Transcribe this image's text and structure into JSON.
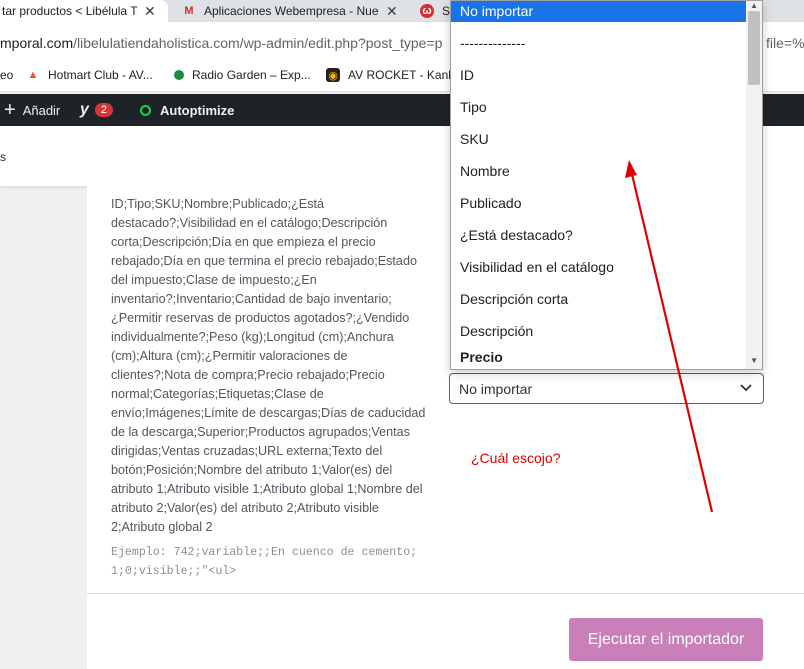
{
  "browser": {
    "tabs": [
      {
        "title": "tar productos < Libélula Ti",
        "close": "✕"
      },
      {
        "title": "Aplicaciones Webempresa - Nue",
        "close": "✕"
      },
      {
        "title": "S"
      }
    ],
    "url_host": "mporal.com",
    "url_rest": "/libelulatiendaholistica.com/wp-admin/edit.php?post_type=p",
    "url_tail": "file=%",
    "bookmarks": [
      {
        "label": "eo"
      },
      {
        "label": "Hotmart Club - AV..."
      },
      {
        "label": "Radio Garden – Exp..."
      },
      {
        "label": "AV ROCKET - Kanba"
      }
    ]
  },
  "adminbar": {
    "add_label": "Añadir",
    "yoast_badge": "2",
    "autoptimize_label": "Autoptimize"
  },
  "header": {
    "text": "s"
  },
  "importer": {
    "column_description": "ID;Tipo;SKU;Nombre;Publicado;¿Está destacado?;Visibilidad en el catálogo;Descripción corta;Descripción;Día en que empieza el precio rebajado;Día en que termina el precio rebajado;Estado del impuesto;Clase de impuesto;¿En inventario?;Inventario;Cantidad de bajo inventario;¿Permitir reservas de productos agotados?;¿Vendido individualmente?;Peso (kg);Longitud (cm);Anchura (cm);Altura (cm);¿Permitir valoraciones de clientes?;Nota de compra;Precio rebajado;Precio normal;Categorías;Etiquetas;Clase de envío;Imágenes;Límite de descargas;Días de caducidad de la descarga;Superior;Productos agrupados;Ventas dirigidas;Ventas cruzadas;URL externa;Texto del botón;Posición;Nombre del atributo 1;Valor(es) del atributo 1;Atributo visible 1;Atributo global 1;Nombre del atributo 2;Valor(es) del atributo 2;Atributo visible 2;Atributo global 2",
    "example": "Ejemplo: 742;variable;;En cuenco de cemento; 1;0;visible;;\"<ul>",
    "select_value": "No importar",
    "annotation": "¿Cuál escojo?",
    "run_button": "Ejecutar el importador"
  },
  "dropdown": {
    "options": [
      {
        "label": "No importar",
        "selected": true
      },
      {
        "label": "--------------"
      },
      {
        "label": "ID"
      },
      {
        "label": "Tipo"
      },
      {
        "label": "SKU"
      },
      {
        "label": "Nombre"
      },
      {
        "label": "Publicado"
      },
      {
        "label": "¿Está destacado?"
      },
      {
        "label": "Visibilidad en el catálogo"
      },
      {
        "label": "Descripción corta"
      },
      {
        "label": "Descripción"
      },
      {
        "label": "Precio",
        "group": true
      }
    ]
  },
  "colors": {
    "accent": "#1a73e8",
    "wp_dark": "#1d2327",
    "button": "#c97fb8",
    "annotation": "#e00000"
  }
}
